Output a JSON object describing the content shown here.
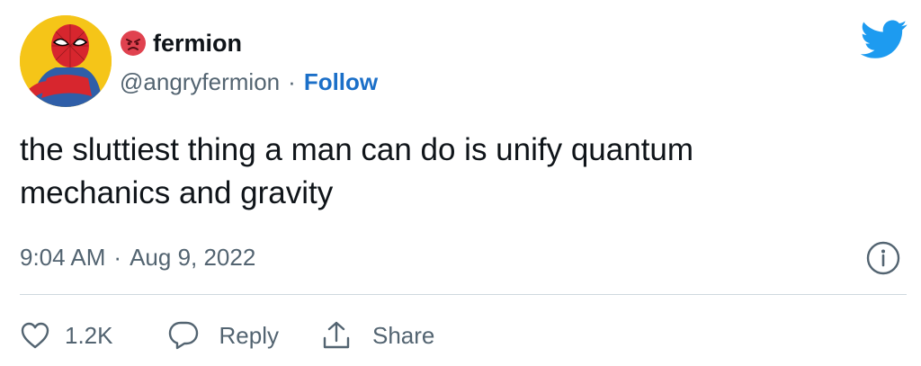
{
  "author": {
    "display_name": "fermion",
    "handle": "@angryfermion",
    "separator": "·",
    "follow_label": "Follow",
    "emoji_icon": "angry-face-icon"
  },
  "tweet": {
    "text_line1": "the sluttiest thing a man can do is unify quantum",
    "text_line2": "mechanics and gravity",
    "time": "9:04 AM",
    "separator": "·",
    "date": "Aug 9, 2022"
  },
  "actions": {
    "like_count": "1.2K",
    "reply_label": "Reply",
    "share_label": "Share"
  },
  "colors": {
    "accent": "#1b6fc8",
    "twitter_blue": "#1d9bf0",
    "muted_text": "#536471",
    "divider": "#cfd9de"
  }
}
